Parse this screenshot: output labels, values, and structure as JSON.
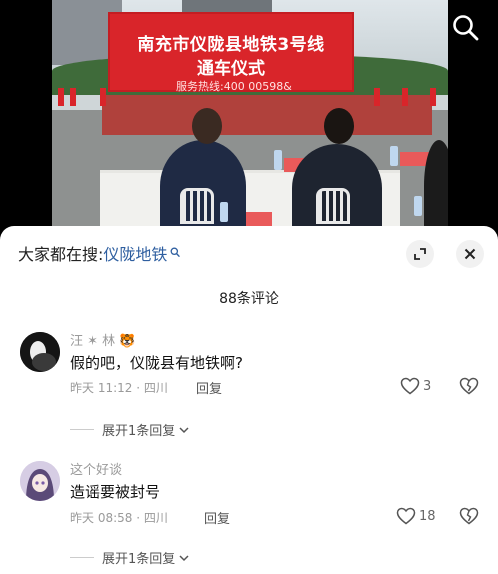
{
  "video": {
    "banner_title": "南充市仪陇县地铁3号线",
    "banner_subtitle": "通车仪式",
    "banner_hotline": "服务热线:400 00598&",
    "search_icon": "search-icon"
  },
  "panel": {
    "trending_prefix": "大家都在搜:",
    "trending_query": "仪陇地铁",
    "trending_icon": "search-icon",
    "fullscreen_icon": "expand-icon",
    "close_icon": "close-icon",
    "comment_count": "88条评论"
  },
  "comments": [
    {
      "name": "汪 ✶ 林 🐯",
      "text": "假的吧，仪陇县有地铁啊?",
      "meta": "昨天 11:12 · 四川",
      "reply": "回复",
      "likes": "3",
      "expand": "展开1条回复"
    },
    {
      "name": "这个好谈",
      "text": "造谣要被封号",
      "meta": "昨天 08:58 · 四川",
      "reply": "回复",
      "likes": "18",
      "expand": "展开1条回复"
    }
  ],
  "colors": {
    "accent_link": "#2f5fa0",
    "banner_red": "#d9252a",
    "muted": "#9a9a9a"
  }
}
